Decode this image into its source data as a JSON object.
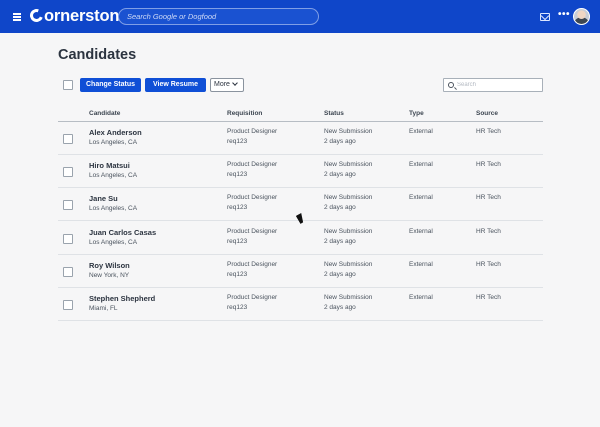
{
  "topbar": {
    "logo_text": "ornerstone",
    "search_placeholder": "Search Google or Dogfood",
    "icons": [
      "menu-icon",
      "mail-icon",
      "more-icon",
      "avatar"
    ]
  },
  "page": {
    "title": "Candidates"
  },
  "toolbar": {
    "change_status_label": "Change Status",
    "view_resume_label": "View Resume",
    "more_label": "More",
    "search_placeholder": "Search"
  },
  "table": {
    "columns": [
      "Candidate",
      "Requisition",
      "Status",
      "Type",
      "Source"
    ],
    "rows": [
      {
        "name": "Alex Anderson",
        "location": "Los Angeles, CA",
        "requisition": "Product Designer",
        "req_id": "req123",
        "status": "New Submission",
        "when": "2 days ago",
        "type": "External",
        "source": "HR Tech"
      },
      {
        "name": "Hiro Matsui",
        "location": "Los Angeles, CA",
        "requisition": "Product Designer",
        "req_id": "req123",
        "status": "New Submission",
        "when": "2 days ago",
        "type": "External",
        "source": "HR Tech"
      },
      {
        "name": "Jane Su",
        "location": "Los Angeles, CA",
        "requisition": "Product Designer",
        "req_id": "req123",
        "status": "New Submission",
        "when": "2 days ago",
        "type": "External",
        "source": "HR Tech"
      },
      {
        "name": "Juan Carlos Casas",
        "location": "Los Angeles, CA",
        "requisition": "Product Designer",
        "req_id": "req123",
        "status": "New Submission",
        "when": "2 days ago",
        "type": "External",
        "source": "HR Tech"
      },
      {
        "name": "Roy Wilson",
        "location": "New York, NY",
        "requisition": "Product Designer",
        "req_id": "req123",
        "status": "New Submission",
        "when": "2 days ago",
        "type": "External",
        "source": "HR Tech"
      },
      {
        "name": "Stephen Shepherd",
        "location": "Miami, FL",
        "requisition": "Product Designer",
        "req_id": "req123",
        "status": "New Submission",
        "when": "2 days ago",
        "type": "External",
        "source": "HR Tech"
      }
    ]
  },
  "colors": {
    "brand_blue": "#0f46c9",
    "button_blue": "#0f4fd6"
  }
}
